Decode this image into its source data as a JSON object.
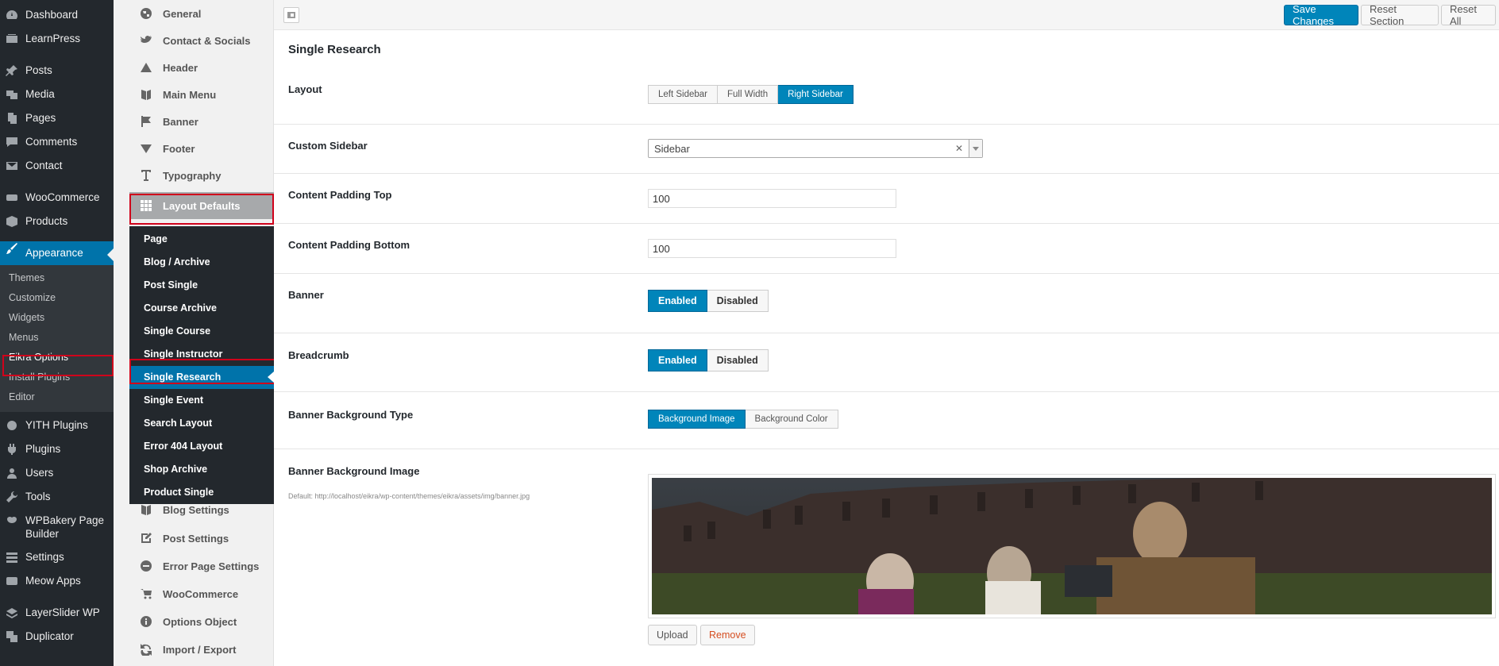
{
  "wp_menu": {
    "items": [
      {
        "label": "Dashboard",
        "icon": "dashboard-icon"
      },
      {
        "label": "LearnPress",
        "icon": "learnpress-icon"
      },
      {
        "label": "Posts",
        "icon": "pin-icon"
      },
      {
        "label": "Media",
        "icon": "media-icon"
      },
      {
        "label": "Pages",
        "icon": "pages-icon"
      },
      {
        "label": "Comments",
        "icon": "comment-icon"
      },
      {
        "label": "Contact",
        "icon": "mail-icon"
      },
      {
        "label": "WooCommerce",
        "icon": "woo-icon"
      },
      {
        "label": "Products",
        "icon": "products-icon"
      },
      {
        "label": "Appearance",
        "icon": "brush-icon"
      },
      {
        "label": "YITH Plugins",
        "icon": "yith-icon"
      },
      {
        "label": "Plugins",
        "icon": "plugin-icon"
      },
      {
        "label": "Users",
        "icon": "users-icon"
      },
      {
        "label": "Tools",
        "icon": "wrench-icon"
      },
      {
        "label": "WPBakery Page Builder",
        "icon": "wpbakery-icon"
      },
      {
        "label": "Settings",
        "icon": "settings-icon"
      },
      {
        "label": "Meow Apps",
        "icon": "meow-icon"
      },
      {
        "label": "LayerSlider WP",
        "icon": "layers-icon"
      },
      {
        "label": "Duplicator",
        "icon": "duplicator-icon"
      }
    ],
    "appearance_sub": [
      "Themes",
      "Customize",
      "Widgets",
      "Menus",
      "Eikra Options",
      "Install Plugins",
      "Editor"
    ]
  },
  "redux_nav": {
    "top_items": [
      {
        "label": "General",
        "icon": "globe-icon"
      },
      {
        "label": "Contact & Socials",
        "icon": "twitter-icon"
      },
      {
        "label": "Header",
        "icon": "triangle-up-icon"
      },
      {
        "label": "Main Menu",
        "icon": "book-icon"
      },
      {
        "label": "Banner",
        "icon": "flag-icon"
      },
      {
        "label": "Footer",
        "icon": "triangle-down-icon"
      },
      {
        "label": "Typography",
        "icon": "typography-icon"
      },
      {
        "label": "Layout Defaults",
        "icon": "grid-icon"
      }
    ],
    "layout_sub": [
      "Page",
      "Blog / Archive",
      "Post Single",
      "Course Archive",
      "Single Course",
      "Single Instructor",
      "Single Research",
      "Single Event",
      "Search Layout",
      "Error 404 Layout",
      "Shop Archive",
      "Product Single"
    ],
    "bottom_items": [
      {
        "label": "Blog Settings",
        "icon": "book-icon"
      },
      {
        "label": "Post Settings",
        "icon": "edit-icon"
      },
      {
        "label": "Error Page Settings",
        "icon": "minus-circle-icon"
      },
      {
        "label": "WooCommerce",
        "icon": "cart-icon"
      },
      {
        "label": "Options Object",
        "icon": "info-icon"
      },
      {
        "label": "Import / Export",
        "icon": "refresh-icon"
      }
    ]
  },
  "toolbar": {
    "save_label": "Save Changes",
    "reset_section_label": "Reset Section",
    "reset_all_label": "Reset All"
  },
  "section": {
    "title": "Single Research",
    "layout": {
      "label": "Layout",
      "options": [
        "Left Sidebar",
        "Full Width",
        "Right Sidebar"
      ],
      "selected": "Right Sidebar"
    },
    "custom_sidebar": {
      "label": "Custom Sidebar",
      "value": "Sidebar"
    },
    "padding_top": {
      "label": "Content Padding Top",
      "value": "100"
    },
    "padding_bottom": {
      "label": "Content Padding Bottom",
      "value": "100"
    },
    "banner": {
      "label": "Banner",
      "options": [
        "Enabled",
        "Disabled"
      ],
      "selected": "Enabled"
    },
    "breadcrumb": {
      "label": "Breadcrumb",
      "options": [
        "Enabled",
        "Disabled"
      ],
      "selected": "Enabled"
    },
    "banner_bg_type": {
      "label": "Banner Background Type",
      "options": [
        "Background Image",
        "Background Color"
      ],
      "selected": "Background Image"
    },
    "banner_bg_image": {
      "label": "Banner Background Image",
      "desc": "Default: http://localhost/eikra/wp-content/themes/eikra/assets/img/banner.jpg",
      "upload_label": "Upload",
      "remove_label": "Remove"
    }
  },
  "colors": {
    "accent": "#0085ba",
    "highlight": "#d0021b",
    "admin_bar": "#23282d"
  }
}
